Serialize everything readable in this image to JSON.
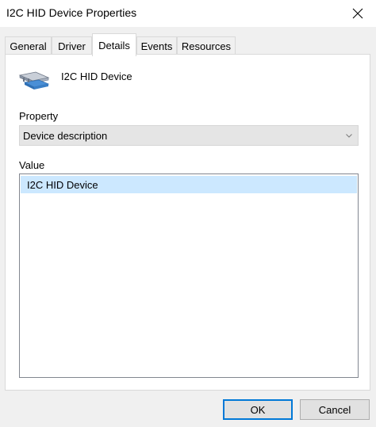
{
  "window": {
    "title": "I2C HID Device Properties",
    "close_icon": "close-icon"
  },
  "tabs": [
    {
      "label": "General",
      "active": false
    },
    {
      "label": "Driver",
      "active": false
    },
    {
      "label": "Details",
      "active": true
    },
    {
      "label": "Events",
      "active": false
    },
    {
      "label": "Resources",
      "active": false
    }
  ],
  "details": {
    "device_icon": "device-icon",
    "device_name": "I2C HID Device",
    "property_label": "Property",
    "property_selected": "Device description",
    "value_label": "Value",
    "values": [
      "I2C HID Device"
    ]
  },
  "footer": {
    "ok_label": "OK",
    "cancel_label": "Cancel"
  },
  "colors": {
    "selection": "#cce8ff",
    "default_button_border": "#0078d7"
  }
}
